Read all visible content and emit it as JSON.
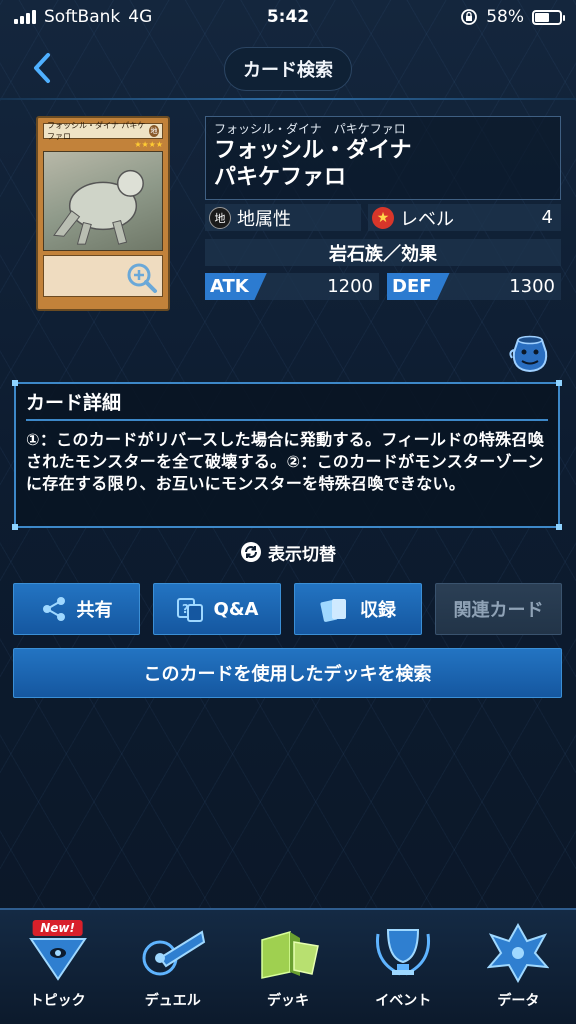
{
  "status_bar": {
    "carrier": "SoftBank",
    "network": "4G",
    "time": "5:42",
    "battery": "58%",
    "battery_level": 0.58
  },
  "header": {
    "title": "カード検索"
  },
  "card": {
    "image_name": "フォッシル・ダイナ パキケファロ",
    "image_attr": "地",
    "ruby": "フォッシル・ダイナ　パキケファロ",
    "name_line1": "フォッシル・ダイナ",
    "name_line2": "パキケファロ",
    "attribute": "地属性",
    "attribute_icon": "地",
    "level_label": "レベル",
    "level": "4",
    "type": "岩石族／効果",
    "atk_label": "ATK",
    "atk": "1200",
    "def_label": "DEF",
    "def": "1300"
  },
  "details": {
    "title": "カード詳細",
    "text": "①：このカードがリバースした場合に発動する。フィールドの特殊召喚されたモンスターを全て破壊する。②：このカードがモンスターゾーンに存在する限り、お互いにモンスターを特殊召喚できない。"
  },
  "toggle_label": "表示切替",
  "buttons": {
    "share": "共有",
    "qa": "Q&A",
    "record": "収録",
    "related": "関連カード",
    "deck_search": "このカードを使用したデッキを検索"
  },
  "nav": {
    "badge": "New!",
    "topic": "トピック",
    "duel": "デュエル",
    "deck": "デッキ",
    "event": "イベント",
    "data": "データ"
  },
  "colors": {
    "accent": "#2374c2",
    "background": "#0c1b2e",
    "badge": "#d8202a"
  }
}
